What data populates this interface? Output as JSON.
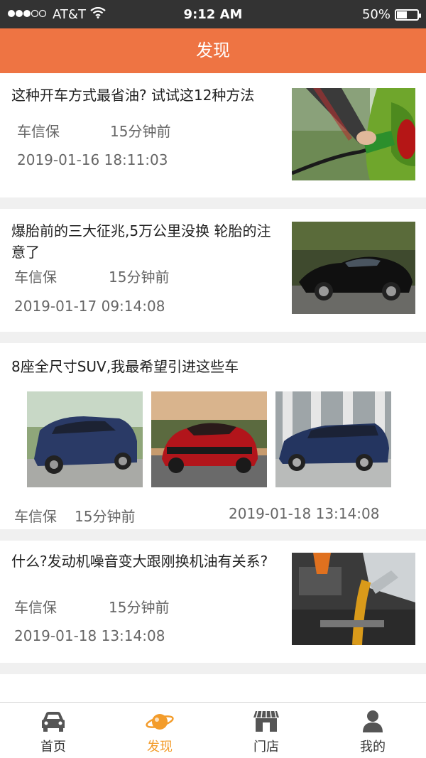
{
  "status_bar": {
    "carrier": "AT&T",
    "time": "9:12 AM",
    "battery": "50%",
    "battery_level": 0.5
  },
  "header": {
    "title": "发现"
  },
  "articles": [
    {
      "title": "这种开车方式最省油? 试试这12种方法",
      "source": "车信保",
      "ago": "15分钟前",
      "date": "2019-01-16 18:11:03",
      "image": "fuel-nozzle-car-photo"
    },
    {
      "title": "爆胎前的三大征兆,5万公里没换 轮胎的注意了",
      "source": "车信保",
      "ago": "15分钟前",
      "date": "2019-01-17 09:14:08",
      "image": "black-sports-car-photo"
    },
    {
      "title": "8座全尺寸SUV,我最希望引进这些车",
      "source": "车信保",
      "ago": "15分钟前",
      "date": "2019-01-18 13:14:08",
      "images": [
        "blue-suv-photo",
        "red-muscle-car-photo",
        "blue-wagon-photo"
      ]
    },
    {
      "title": "什么?发动机噪音变大跟刚换机油有关系?",
      "source": "车信保",
      "ago": "15分钟前",
      "date": "2019-01-18 13:14:08",
      "image": "engine-oil-pour-photo"
    }
  ],
  "tabbar": {
    "items": [
      {
        "label": "首页",
        "icon": "car-icon",
        "active": false
      },
      {
        "label": "发现",
        "icon": "planet-icon",
        "active": true,
        "active_color": "#f39c2b"
      },
      {
        "label": "门店",
        "icon": "store-icon",
        "active": false
      },
      {
        "label": "我的",
        "icon": "person-icon",
        "active": false
      }
    ]
  },
  "colors": {
    "header": "#ee7443",
    "active_tab": "#f39c2b",
    "status_bar": "#333333"
  }
}
